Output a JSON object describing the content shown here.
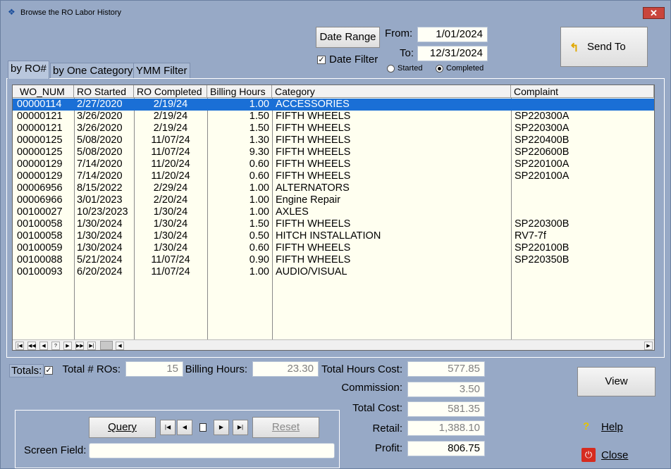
{
  "window": {
    "title": "Browse the RO Labor History",
    "close_glyph": "✕"
  },
  "date": {
    "range_button": "Date Range",
    "filter_label": "Date Filter",
    "filter_checked": true,
    "from_label": "From:",
    "from_value": "1/01/2024",
    "to_label": "To:",
    "to_value": "12/31/2024",
    "radio_started": "Started",
    "radio_completed": "Completed",
    "selected": "Completed"
  },
  "send_to": {
    "label": "Send To"
  },
  "tabs": [
    {
      "label": "by RO#",
      "active": true
    },
    {
      "label": "by One Category",
      "active": false
    },
    {
      "label": "YMM Filter",
      "active": false
    }
  ],
  "grid": {
    "columns": [
      "WO_NUM",
      "RO Started",
      "RO Completed",
      "Billing Hours",
      "Category",
      "Complaint"
    ],
    "rows": [
      [
        "00000114",
        "2/27/2020",
        "2/19/24",
        "1.00",
        "ACCESSORIES",
        ""
      ],
      [
        "00000121",
        "3/26/2020",
        "2/19/24",
        "1.50",
        "FIFTH WHEELS",
        "SP220300A"
      ],
      [
        "00000121",
        "3/26/2020",
        "2/19/24",
        "1.50",
        "FIFTH WHEELS",
        "SP220300A"
      ],
      [
        "00000125",
        "5/08/2020",
        "11/07/24",
        "1.30",
        "FIFTH WHEELS",
        "SP220400B"
      ],
      [
        "00000125",
        "5/08/2020",
        "11/07/24",
        "9.30",
        "FIFTH WHEELS",
        "SP220600B"
      ],
      [
        "00000129",
        "7/14/2020",
        "11/20/24",
        "0.60",
        "FIFTH WHEELS",
        "SP220100A"
      ],
      [
        "00000129",
        "7/14/2020",
        "11/20/24",
        "0.60",
        "FIFTH WHEELS",
        "SP220100A"
      ],
      [
        "00006956",
        "8/15/2022",
        "2/29/24",
        "1.00",
        "ALTERNATORS",
        ""
      ],
      [
        "00006966",
        "3/01/2023",
        "2/20/24",
        "1.00",
        "Engine Repair",
        ""
      ],
      [
        "00100027",
        "10/23/2023",
        "1/30/24",
        "1.00",
        "AXLES",
        ""
      ],
      [
        "00100058",
        "1/30/2024",
        "1/30/24",
        "1.50",
        "FIFTH WHEELS",
        "SP220300B"
      ],
      [
        "00100058",
        "1/30/2024",
        "1/30/24",
        "0.50",
        "HITCH INSTALLATION",
        "RV7-7f"
      ],
      [
        "00100059",
        "1/30/2024",
        "1/30/24",
        "0.60",
        "FIFTH WHEELS",
        "SP220100B"
      ],
      [
        "00100088",
        "5/21/2024",
        "11/07/24",
        "0.90",
        "FIFTH WHEELS",
        "SP220350B"
      ],
      [
        "00100093",
        "6/20/2024",
        "11/07/24",
        "1.00",
        "AUDIO/VISUAL",
        ""
      ]
    ],
    "selected_row": 0,
    "nav_glyphs": [
      "|◀",
      "◀◀",
      "◀",
      "?",
      "▶",
      "▶▶",
      "▶|"
    ]
  },
  "totals": {
    "label": "Totals:",
    "checked": true,
    "total_ros_label": "Total # ROs:",
    "total_ros": "15",
    "billing_hours_label": "Billing Hours:",
    "billing_hours": "23.30",
    "total_hours_cost_label": "Total Hours Cost:",
    "total_hours_cost": "577.85",
    "commission_label": "Commission:",
    "commission": "3.50",
    "total_cost_label": "Total Cost:",
    "total_cost": "581.35",
    "retail_label": "Retail:",
    "retail": "1,388.10",
    "profit_label": "Profit:",
    "profit": "806.75"
  },
  "query": {
    "query_button": "Query",
    "reset_button": "Reset",
    "screen_field_label": "Screen Field:",
    "screen_field_value": ""
  },
  "actions": {
    "view": "View",
    "help": "Help",
    "close": "Close"
  }
}
